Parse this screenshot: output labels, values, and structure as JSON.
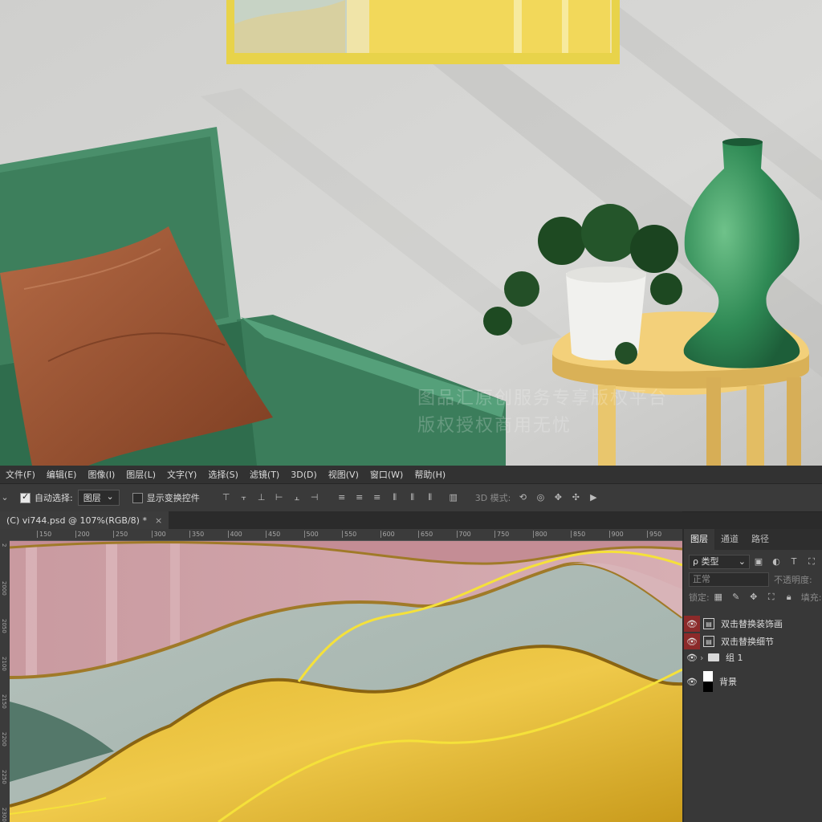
{
  "watermark": {
    "line1": "图品汇原创服务专享版权平台",
    "line2": "版权授权商用无忧"
  },
  "menu": [
    "文件(F)",
    "编辑(E)",
    "图像(I)",
    "图层(L)",
    "文字(Y)",
    "选择(S)",
    "滤镜(T)",
    "3D(D)",
    "视图(V)",
    "窗口(W)",
    "帮助(H)"
  ],
  "options": {
    "auto_select_label": "自动选择:",
    "auto_select_checked": true,
    "auto_select_value": "图层",
    "show_transform_label": "显示变换控件",
    "show_transform_checked": false,
    "mode3d_label": "3D 模式:"
  },
  "document_tab": {
    "title": "(C) vi744.psd @ 107%(RGB/8) *",
    "close": "×"
  },
  "ruler": {
    "h_ticks": [
      "150",
      "200",
      "250",
      "300",
      "350",
      "400",
      "450",
      "500",
      "550",
      "600",
      "650",
      "700",
      "750",
      "800",
      "850",
      "900",
      "950"
    ],
    "v_ticks": [
      "2",
      "2000",
      "2050",
      "2100",
      "2150",
      "2200",
      "2250",
      "2300"
    ]
  },
  "layers_panel": {
    "tabs": [
      "图层",
      "通道",
      "路径"
    ],
    "active_tab": "图层",
    "filter_label": "ρ 类型",
    "blend_mode": "正常",
    "opacity_label": "不透明度:",
    "lock_label": "锁定:",
    "fill_label": "填充:",
    "layers": [
      {
        "name": "双击替换装饰画",
        "visible": true,
        "highlight": true,
        "type": "smart"
      },
      {
        "name": "双击替换细节",
        "visible": true,
        "highlight": true,
        "type": "smart"
      },
      {
        "name": "组 1",
        "visible": true,
        "highlight": false,
        "type": "group"
      },
      {
        "name": "背景",
        "visible": true,
        "highlight": false,
        "type": "background"
      }
    ]
  },
  "colors": {
    "ps_dark": "#323232",
    "panel": "#383838",
    "eye_highlight": "#8c2a2a",
    "accent_gold": "#e2b72c",
    "sofa_green": "#3f8a62"
  }
}
